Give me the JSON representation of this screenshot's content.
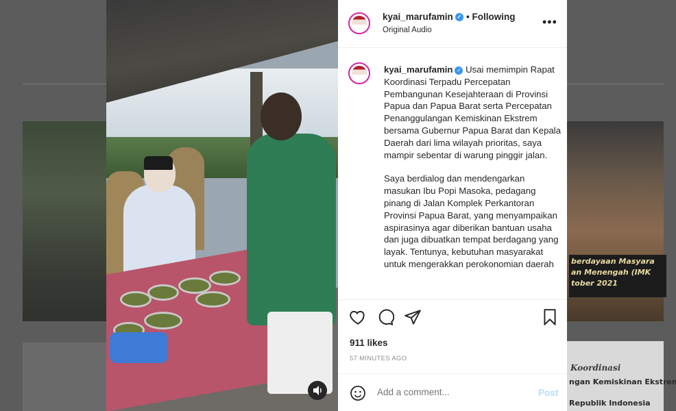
{
  "post": {
    "username": "kyai_marufamin",
    "following_label": "Following",
    "audio_label": "Original Audio",
    "more_icon": "more-options-icon",
    "caption_paragraphs": [
      "Usai memimpin Rapat Koordinasi Terpadu Percepatan Pembangunan Kesejahteraan di Provinsi Papua dan Papua Barat serta Percepatan Penanggulangan Kemiskinan Ekstrem bersama Gubernur Papua Barat dan Kepala Daerah dari lima wilayah prioritas, saya mampir sebentar di warung pinggir jalan.",
      "Saya berdialog dan mendengarkan masukan Ibu Popi Masoka, pedagang pinang di Jalan Komplek Perkantoran Provinsi Papua Barat, yang menyampaikan aspirasinya agar diberikan bantuan usaha dan juga dibuatkan tempat berdagang yang layak. Tentunya, kebutuhan masyarakat untuk mengerakkan perokonomian daerah"
    ],
    "likes": "911 likes",
    "time_ago": "57 MINUTES AGO",
    "comment_placeholder": "Add a comment...",
    "post_button": "Post"
  },
  "background": {
    "banner_lines": [
      "berdayaan Masyara",
      "an Menengah (IMK",
      "tober 2021"
    ],
    "bottom_right": {
      "line1": "Koordinasi",
      "line2": "ngan Kemiskinan Ekstrem",
      "line3": "Republik Indonesia"
    }
  },
  "colors": {
    "verified": "#3897f0",
    "post_button_disabled": "#b2dffc",
    "avatar_ring": "#d6249f"
  }
}
